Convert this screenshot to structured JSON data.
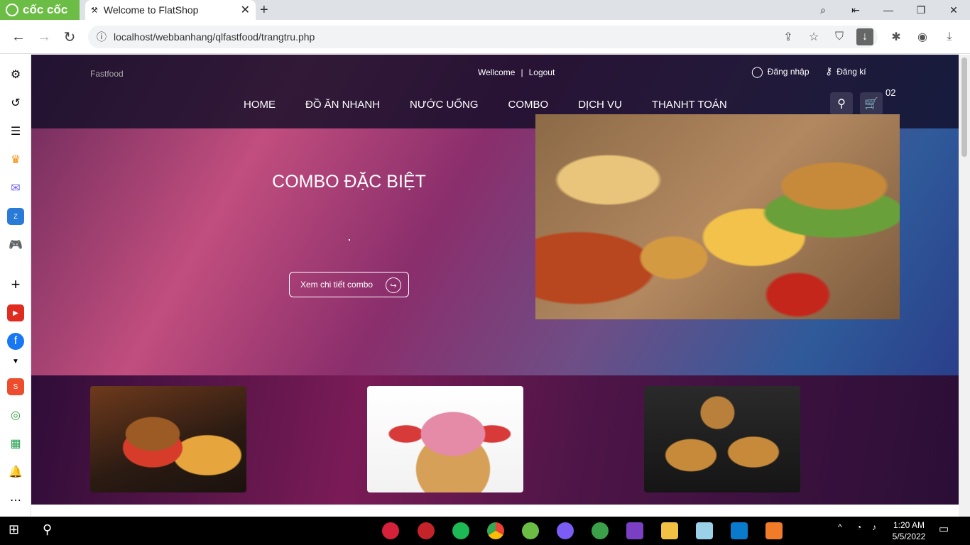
{
  "browser": {
    "brand": "cốc cốc",
    "tab_title": "Welcome to FlatShop",
    "url": "localhost/webbanhang/qlfastfood/trangtru.php"
  },
  "site": {
    "logo_alt": "Fastfood",
    "welcome": "Wellcome",
    "separator": "|",
    "logout": "Logout",
    "login": "Đăng nhập",
    "register": "Đăng kí",
    "menu": [
      "HOME",
      "ĐỒ ĂN NHANH",
      "NƯỚC UỐNG",
      "COMBO",
      "DỊCH VỤ",
      "THANHT TOÁN"
    ],
    "cart_count": "02"
  },
  "hero": {
    "title": "COMBO ĐẶC BIỆT",
    "button": "Xem chi tiết combo"
  },
  "taskbar": {
    "time": "1:20 AM",
    "date": "5/5/2022"
  }
}
